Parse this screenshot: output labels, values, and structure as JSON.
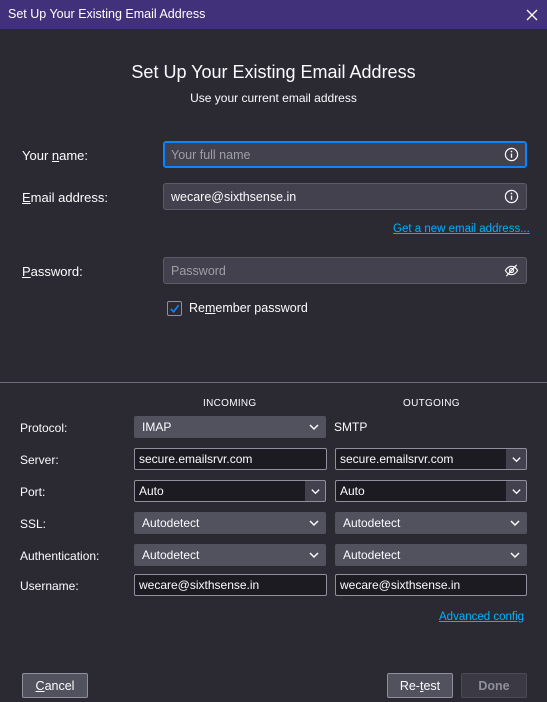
{
  "window": {
    "title": "Set Up Your Existing Email Address",
    "close_glyph": "✕"
  },
  "header": {
    "heading": "Set Up Your Existing Email Address",
    "subheading": "Use your current email address"
  },
  "form": {
    "name_label_prefix": "Your ",
    "name_label_ul": "n",
    "name_label_suffix": "ame:",
    "name_placeholder": "Your full name",
    "name_value": "",
    "email_label_ul": "E",
    "email_label_suffix": "mail address:",
    "email_value": "wecare@sixthsense.in",
    "new_email_link": "Get a new email address...",
    "password_label_ul": "P",
    "password_label_suffix": "assword:",
    "password_placeholder": "Password",
    "remember_prefix": "Re",
    "remember_ul": "m",
    "remember_suffix": "ember password",
    "remember_checked": true
  },
  "config": {
    "incoming_header": "INCOMING",
    "outgoing_header": "OUTGOING",
    "labels": {
      "protocol": "Protocol:",
      "server": "Server:",
      "port": "Port:",
      "ssl": "SSL:",
      "authentication": "Authentication:",
      "username": "Username:"
    },
    "incoming": {
      "protocol": "IMAP",
      "server": "secure.emailsrvr.com",
      "port": "Auto",
      "ssl": "Autodetect",
      "authentication": "Autodetect",
      "username": "wecare@sixthsense.in"
    },
    "outgoing": {
      "protocol": "SMTP",
      "server": "secure.emailsrvr.com",
      "port": "Auto",
      "ssl": "Autodetect",
      "authentication": "Autodetect",
      "username": "wecare@sixthsense.in"
    },
    "advanced_link": "Advanced config"
  },
  "buttons": {
    "cancel_prefix": "",
    "cancel_ul": "C",
    "cancel_suffix": "ancel",
    "retest_prefix": "Re-",
    "retest_ul": "t",
    "retest_suffix": "est",
    "done": "Done"
  },
  "colors": {
    "titlebar": "#40317a",
    "background": "#2b2a33",
    "accent": "#0a84ff",
    "link": "#00b2ff"
  },
  "icons": {
    "info": "info-icon",
    "eye_slash": "eye-slash-icon",
    "chevron": "chevron-down-icon",
    "check": "checkmark-icon",
    "close": "close-icon"
  }
}
